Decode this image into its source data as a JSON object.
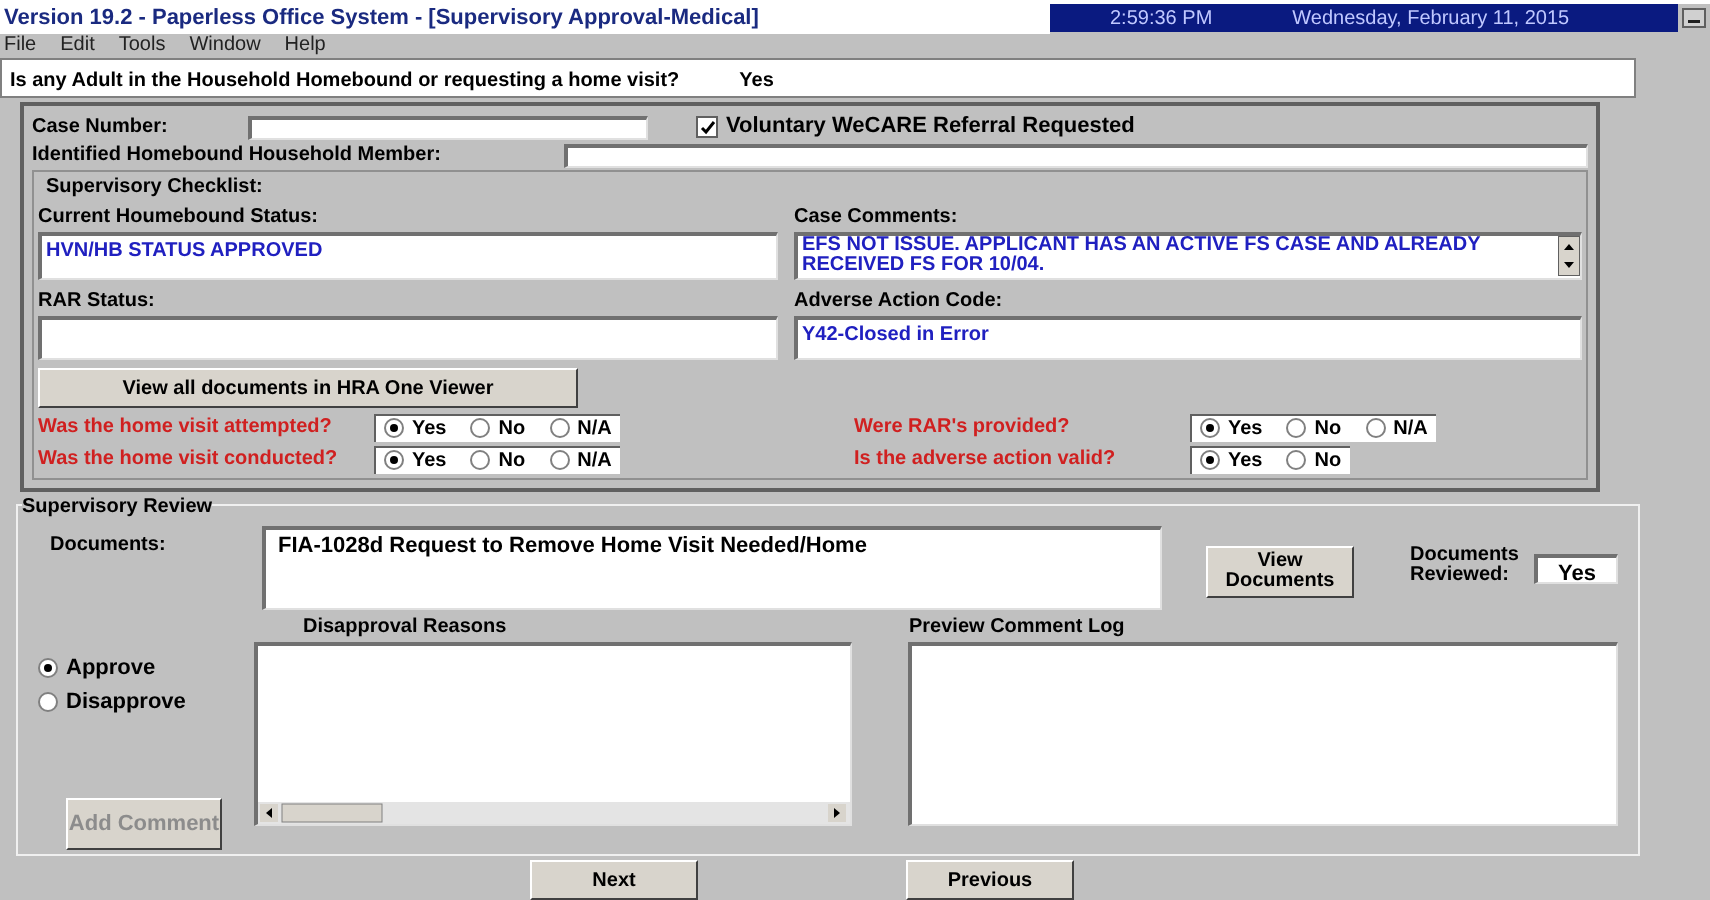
{
  "window": {
    "title": "Version 19.2 - Paperless Office System - [Supervisory Approval-Medical]",
    "time": "2:59:36 PM",
    "date": "Wednesday, February 11, 2015"
  },
  "menu": [
    "File",
    "Edit",
    "Tools",
    "Window",
    "Help"
  ],
  "question": {
    "label": "Is any Adult in the Household Homebound or requesting a home visit?",
    "answer": "Yes"
  },
  "case_number": {
    "label": "Case Number:"
  },
  "voluntary_referral": {
    "label": "Voluntary WeCARE Referral Requested",
    "checked": true
  },
  "homebound_member": {
    "label": "Identified Homebound Household Member:"
  },
  "checklist": {
    "title": "Supervisory Checklist:",
    "current_status": {
      "label": "Current Houmebound Status:",
      "value": "HVN/HB STATUS APPROVED"
    },
    "case_comments": {
      "label": "Case Comments:",
      "value": "EFS NOT ISSUE. APPLICANT HAS AN ACTIVE FS CASE AND ALREADY RECEIVED FS FOR 10/04."
    },
    "rar_status": {
      "label": "RAR Status:"
    },
    "adverse_action_code": {
      "label": "Adverse Action Code:",
      "value": "Y42-Closed in Error"
    },
    "viewer_button": "View all documents in HRA One Viewer",
    "left_questions": [
      {
        "label": "Was the home visit attempted?",
        "options": [
          {
            "label": "Yes",
            "selected": true
          },
          {
            "label": "No",
            "selected": false
          },
          {
            "label": "N/A",
            "selected": false
          }
        ]
      },
      {
        "label": "Was the home visit conducted?",
        "options": [
          {
            "label": "Yes",
            "selected": true
          },
          {
            "label": "No",
            "selected": false
          },
          {
            "label": "N/A",
            "selected": false
          }
        ]
      }
    ],
    "right_questions": [
      {
        "label": "Were RAR's provided?",
        "options": [
          {
            "label": "Yes",
            "selected": true
          },
          {
            "label": "No",
            "selected": false
          },
          {
            "label": "N/A",
            "selected": false
          }
        ]
      },
      {
        "label": "Is the adverse action valid?",
        "options": [
          {
            "label": "Yes",
            "selected": true
          },
          {
            "label": "No",
            "selected": false
          }
        ]
      }
    ]
  },
  "review": {
    "title": "Supervisory Review",
    "documents_label": "Documents:",
    "documents_value": "FIA-1028d Request to Remove Home Visit Needed/Home",
    "view_documents_button": "View Documents",
    "documents_reviewed": {
      "label": "Documents Reviewed:",
      "value": "Yes"
    },
    "decision": [
      {
        "label": "Approve",
        "selected": true
      },
      {
        "label": "Disapprove",
        "selected": false
      }
    ],
    "add_comment_button": {
      "label": "Add Comment",
      "disabled": true
    },
    "disapproval_reasons": {
      "title": "Disapproval Reasons"
    },
    "comment_log": {
      "title": "Preview Comment Log"
    }
  },
  "buttons": [
    "Next",
    "Previous"
  ]
}
